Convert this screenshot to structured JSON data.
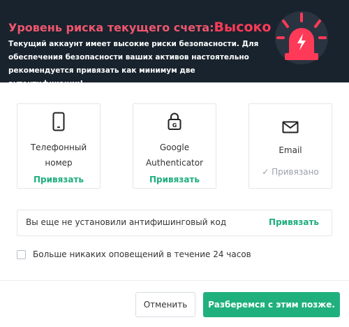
{
  "header": {
    "title_prefix": "Уровень риска текущего счета:",
    "risk_level": "Высоко",
    "description": "Текущий аккаунт имеет высокие риски безопасности. Для обеспечения безопасности ваших активов настоятельно рекомендуется привязать как минимум две аутентификации!",
    "alarm_icon": "alarm-siren-icon",
    "accent_color": "#ff3a58"
  },
  "methods": [
    {
      "icon": "phone-icon",
      "label_line1": "Телефонный",
      "label_line2": "номер",
      "action": "Привязать"
    },
    {
      "icon": "google-authenticator-lock-icon",
      "label_line1": "Google",
      "label_line2": "Authenticator",
      "action": "Привязать"
    },
    {
      "icon": "email-envelope-icon",
      "label_line1": "Email",
      "status": "Привязано"
    }
  ],
  "antiphishing": {
    "text": "Вы еще не установили антифишинговый код",
    "action": "Привязать"
  },
  "mute": {
    "checked": false,
    "label": "Больше никаких оповещений в течение 24 часов"
  },
  "footer": {
    "cancel_label": "Отменить",
    "later_label": "Разберемся с этим позже.",
    "primary_color": "#1fb07d"
  }
}
